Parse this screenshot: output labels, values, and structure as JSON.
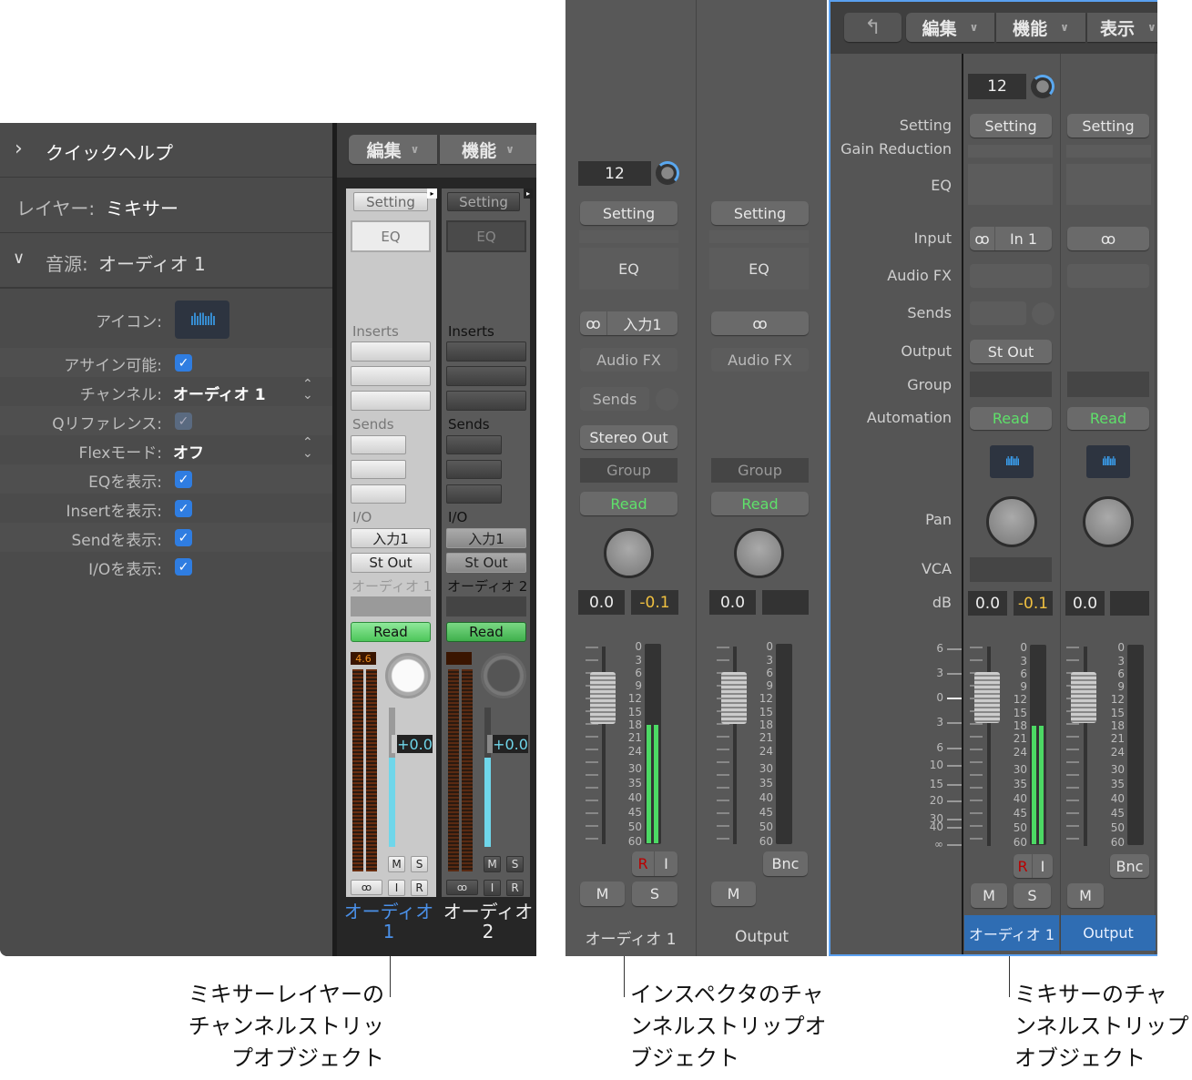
{
  "panel1": {
    "quick_help": "クイックヘルプ",
    "layer_label": "レイヤー:",
    "layer_value": "ミキサー",
    "source_label": "音源:",
    "source_value": "オーディオ 1",
    "rows": [
      {
        "label": "アイコン:"
      },
      {
        "label": "アサイン可能:",
        "checked": true
      },
      {
        "label": "チャンネル:",
        "value": "オーディオ 1"
      },
      {
        "label": "Qリファレンス:",
        "checked": true
      },
      {
        "label": "Flexモード:",
        "value": "オフ"
      },
      {
        "label": "EQを表示:",
        "checked": true
      },
      {
        "label": "Insertを表示:",
        "checked": true
      },
      {
        "label": "Sendを表示:",
        "checked": true
      },
      {
        "label": "I/Oを表示:",
        "checked": true
      }
    ],
    "check_glyph": "✓",
    "menu": {
      "edit": "編集",
      "function": "機能"
    },
    "strips": [
      {
        "setting": "Setting",
        "eq": "EQ",
        "inserts": "Inserts",
        "sends": "Sends",
        "io": "I/O",
        "input": "入力1",
        "output": "St Out",
        "track": "オーディオ 1",
        "automation": "Read",
        "peak": "4.6",
        "volume": "+0.0",
        "mute": "M",
        "solo": "S",
        "input_mon": "I",
        "record": "R",
        "name_line1": "オーディオ",
        "name_line2": "1"
      },
      {
        "setting": "Setting",
        "eq": "EQ",
        "inserts": "Inserts",
        "sends": "Sends",
        "io": "I/O",
        "input": "入力1",
        "output": "St Out",
        "track": "オーディオ 2",
        "automation": "Read",
        "peak": "",
        "volume": "+0.0",
        "mute": "M",
        "solo": "S",
        "input_mon": "I",
        "record": "R",
        "name_line1": "オーディオ",
        "name_line2": "2"
      }
    ]
  },
  "panel2": {
    "strips": [
      {
        "gain": "12",
        "setting": "Setting",
        "eq": "EQ",
        "input": "入力1",
        "audio_fx": "Audio FX",
        "sends": "Sends",
        "output": "Stereo Out",
        "group": "Group",
        "automation": "Read",
        "volume": "0.0",
        "peak": "-0.1",
        "record": "R",
        "input_mon": "I",
        "mute": "M",
        "solo": "S",
        "name": "オーディオ 1",
        "meter_level_db": -18
      },
      {
        "setting": "Setting",
        "eq": "EQ",
        "audio_fx": "Audio FX",
        "group": "Group",
        "automation": "Read",
        "volume": "0.0",
        "peak": "",
        "bounce": "Bnc",
        "mute": "M",
        "name": "Output",
        "meter_level_db": null
      }
    ]
  },
  "panel3": {
    "menu": {
      "edit": "編集",
      "function": "機能",
      "view": "表示"
    },
    "labels": {
      "setting": "Setting",
      "gain_reduction": "Gain Reduction",
      "eq": "EQ",
      "input": "Input",
      "audio_fx": "Audio FX",
      "sends": "Sends",
      "output": "Output",
      "group": "Group",
      "automation": "Automation",
      "pan": "Pan",
      "vca": "VCA",
      "db": "dB"
    },
    "fader_scale": [
      "6",
      "3",
      "0",
      "3",
      "6",
      "10",
      "15",
      "20",
      "30",
      "40",
      "∞"
    ],
    "strips": [
      {
        "gain": "12",
        "setting": "Setting",
        "input": "In 1",
        "output": "St Out",
        "automation": "Read",
        "volume": "0.0",
        "peak": "-0.1",
        "record": "R",
        "input_mon": "I",
        "mute": "M",
        "solo": "S",
        "name": "オーディオ 1",
        "meter_level_db": -18
      },
      {
        "setting": "Setting",
        "automation": "Read",
        "volume": "0.0",
        "peak": "",
        "bounce": "Bnc",
        "mute": "M",
        "name": "Output",
        "meter_level_db": null
      }
    ]
  },
  "meter_scale": [
    "0",
    "3",
    "6",
    "9",
    "12",
    "15",
    "18",
    "21",
    "24",
    "30",
    "35",
    "40",
    "45",
    "50",
    "60"
  ],
  "captions": {
    "c1": [
      "ミキサーレイヤーの",
      "チャンネルストリッ",
      "プオブジェクト"
    ],
    "c2": [
      "インスペクタのチャ",
      "ンネルストリップオ",
      "ブジェクト"
    ],
    "c3": [
      "ミキサーのチャ",
      "ンネルストリップ",
      "オブジェクト"
    ]
  },
  "colors": {
    "accent": "#2f7de1",
    "read": "#5fe06a",
    "peak": "#f0c040",
    "selected_name": "#2f6db3",
    "meter": "#4cd964"
  }
}
